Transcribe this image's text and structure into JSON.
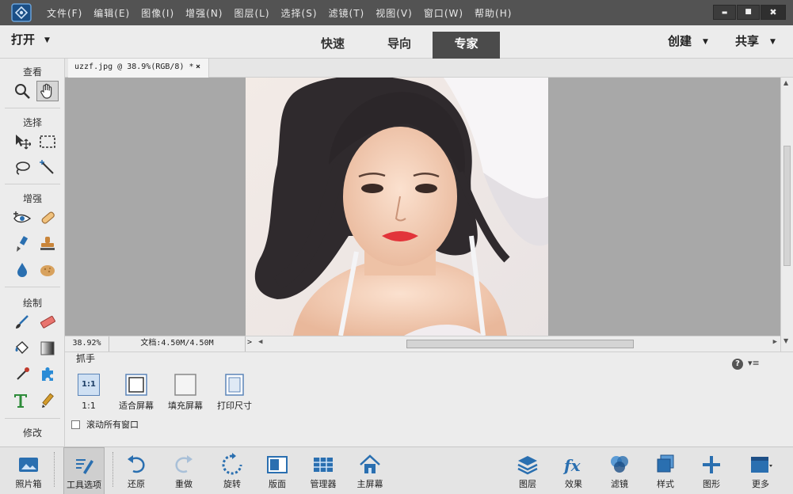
{
  "app": {
    "menus": [
      "文件(F)",
      "编辑(E)",
      "图像(I)",
      "增强(N)",
      "图层(L)",
      "选择(S)",
      "滤镜(T)",
      "视图(V)",
      "窗口(W)",
      "帮助(H)"
    ],
    "window_controls": {
      "minimize": "▬",
      "maximize": "■",
      "close": "✖"
    }
  },
  "modebar": {
    "open_label": "打开",
    "tabs": {
      "quick": "快速",
      "guided": "导向",
      "expert": "专家"
    },
    "active_tab": "expert",
    "create_label": "创建",
    "share_label": "共享"
  },
  "toolbox": {
    "sections": {
      "view": "查看",
      "select": "选择",
      "enhance": "增强",
      "draw": "绘制",
      "modify": "修改"
    },
    "active_tool": "hand-tool",
    "tools": [
      "zoom",
      "hand",
      "move",
      "marquee",
      "lasso",
      "magic-wand",
      "red-eye",
      "spot-healing",
      "smart-brush",
      "clone-stamp",
      "blur",
      "sponge",
      "brush",
      "eraser",
      "paint-bucket",
      "gradient",
      "eyedropper",
      "custom-shape",
      "type",
      "pencil"
    ]
  },
  "document": {
    "tab_title": "uzzf.jpg @ 38.9%(RGB/8) *",
    "tab_close": "×",
    "zoom": "38.92%",
    "doc_info": "文档:4.50M/4.50M"
  },
  "tool_options": {
    "title": "抓手",
    "buttons": [
      {
        "key": "actual",
        "icon_text": "1:1",
        "label": "1:1"
      },
      {
        "key": "fit",
        "label": "适合屏幕"
      },
      {
        "key": "fill",
        "label": "填充屏幕"
      },
      {
        "key": "print",
        "label": "打印尺寸"
      }
    ],
    "checkbox_label": "滚动所有窗口",
    "checkbox_checked": false,
    "help_icon": "?",
    "menu_icon": "▾≡"
  },
  "taskbar": {
    "left": [
      {
        "key": "photo-bin",
        "label": "照片箱"
      },
      {
        "key": "tool-options",
        "label": "工具选项",
        "active": true
      },
      {
        "key": "undo",
        "label": "还原"
      },
      {
        "key": "redo",
        "label": "重做"
      },
      {
        "key": "rotate",
        "label": "旋转"
      },
      {
        "key": "layout",
        "label": "版面"
      },
      {
        "key": "organizer",
        "label": "管理器"
      },
      {
        "key": "home-screen",
        "label": "主屏幕"
      }
    ],
    "right": [
      {
        "key": "layers",
        "label": "图层"
      },
      {
        "key": "effects",
        "label": "效果"
      },
      {
        "key": "filters",
        "label": "滤镜"
      },
      {
        "key": "styles",
        "label": "样式"
      },
      {
        "key": "graphics",
        "label": "图形"
      },
      {
        "key": "more",
        "label": "更多"
      }
    ]
  },
  "colors": {
    "accent_blue": "#2a6fb0",
    "menubar_bg": "#535353",
    "panel_bg": "#ececec",
    "canvas_bg": "#a8a8a8"
  }
}
